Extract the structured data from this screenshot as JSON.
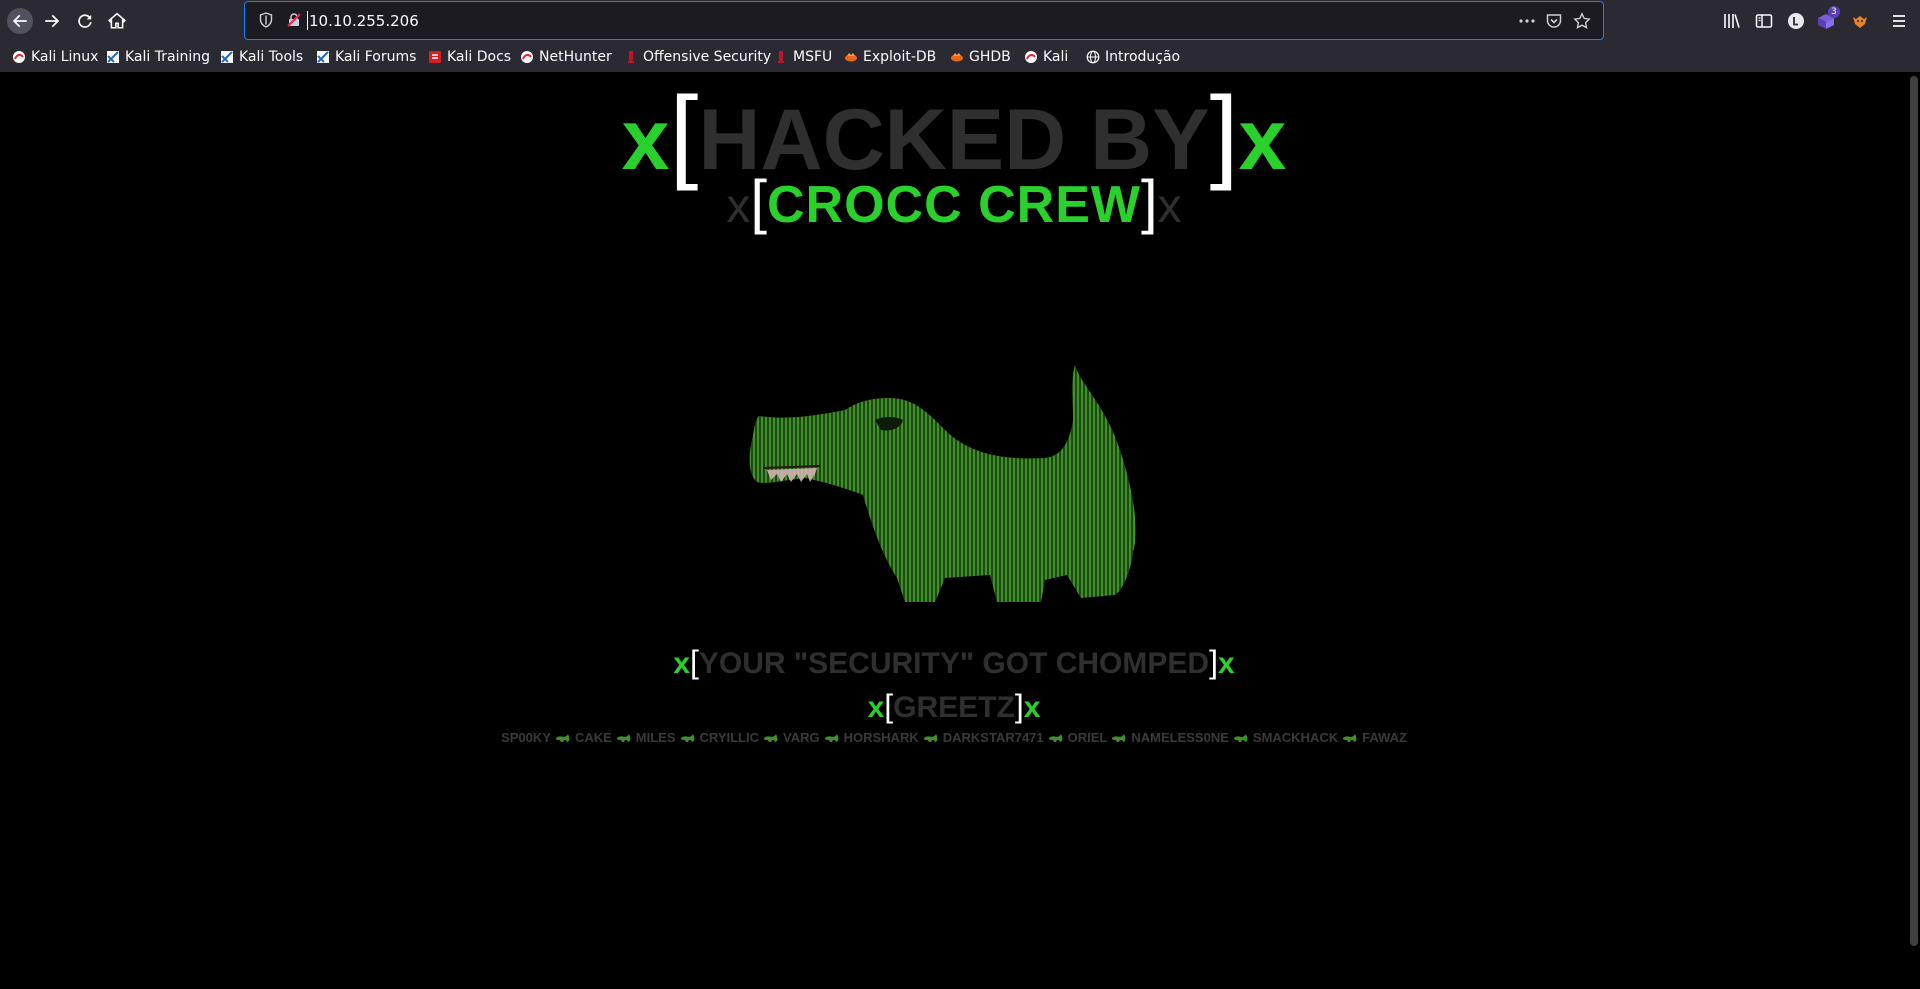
{
  "browser": {
    "url": "10.10.255.206",
    "extension_badge_count": "3",
    "bookmarks": [
      {
        "label": "Kali Linux",
        "icon": "kali-dragon-icon"
      },
      {
        "label": "Kali Training",
        "icon": "kali-training-icon"
      },
      {
        "label": "Kali Tools",
        "icon": "kali-tools-icon"
      },
      {
        "label": "Kali Forums",
        "icon": "kali-forums-icon"
      },
      {
        "label": "Kali Docs",
        "icon": "kali-docs-icon"
      },
      {
        "label": "NetHunter",
        "icon": "kali-dragon-icon"
      },
      {
        "label": "Offensive Security",
        "icon": "offsec-icon"
      },
      {
        "label": "MSFU",
        "icon": "offsec-icon"
      },
      {
        "label": "Exploit-DB",
        "icon": "exploit-db-icon"
      },
      {
        "label": "GHDB",
        "icon": "exploit-db-icon"
      },
      {
        "label": "Kali",
        "icon": "kali-dragon-icon"
      },
      {
        "label": "Introdução",
        "icon": "globe-icon"
      }
    ]
  },
  "page": {
    "title": {
      "x_left": "x",
      "open": "[",
      "text": "HACKED BY",
      "close": "]",
      "x_right": "x"
    },
    "subtitle": {
      "x_left": "x",
      "open": "[",
      "text": "CROCC CREW",
      "close": "]",
      "x_right": "x"
    },
    "tagline": {
      "x_left": "x",
      "open": "[",
      "text": "YOUR \"SECURITY\" GOT CHOMPED",
      "close": "]",
      "x_right": "x"
    },
    "greetz": {
      "x_left": "x",
      "open": "[",
      "text": "GREETZ",
      "close": "]",
      "x_right": "x"
    },
    "greets": [
      "SP00KY",
      "CAKE",
      "MILES",
      "CRYILLIC",
      "VARG",
      "HORSHARK",
      "DARKSTAR7471",
      "ORIEL",
      "NAMELESS0NE",
      "SMACKHACK",
      "FAWAZ"
    ],
    "colors": {
      "accent_green": "#2ad12c",
      "dim_gray": "#2f2f2f",
      "background": "#000000"
    }
  }
}
